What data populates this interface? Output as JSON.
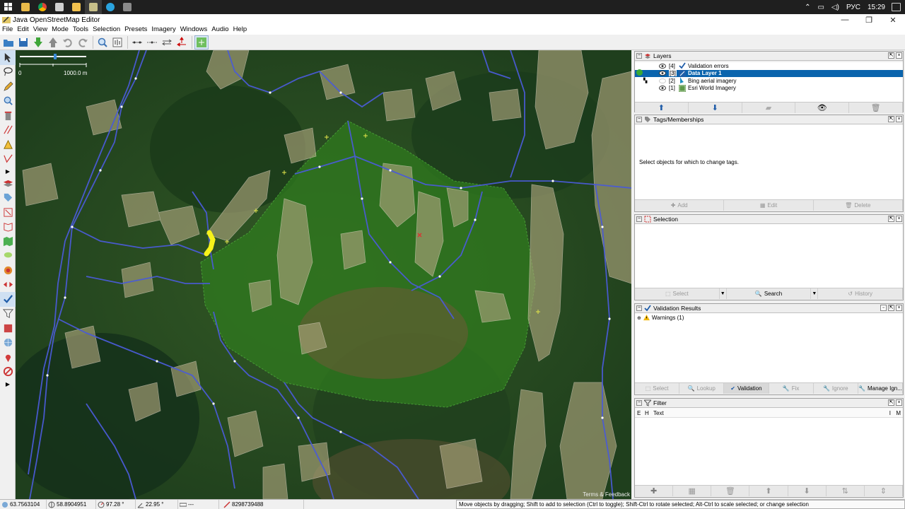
{
  "taskbar": {
    "apps": [
      {
        "name": "windows-icon",
        "color": "#ffffff"
      },
      {
        "name": "explorer-icon",
        "color": "#f2c14e"
      },
      {
        "name": "chrome-icon",
        "color": "#4caf50"
      },
      {
        "name": "desktop-icon",
        "color": "#d0d0d0"
      },
      {
        "name": "folder-icon",
        "color": "#f4c542"
      },
      {
        "name": "josm-icon",
        "color": "#d7c77a"
      },
      {
        "name": "telegram-icon",
        "color": "#2aa3de"
      },
      {
        "name": "calculator-icon",
        "color": "#9e9e9e"
      }
    ],
    "lang": "РУС",
    "time": "15:29"
  },
  "window": {
    "title": "Java OpenStreetMap Editor",
    "controls": [
      "—",
      "❐",
      "✕"
    ]
  },
  "menu": [
    "File",
    "Edit",
    "View",
    "Mode",
    "Tools",
    "Selection",
    "Presets",
    "Imagery",
    "Windows",
    "Audio",
    "Help"
  ],
  "map": {
    "scale_start": "0",
    "scale_end": "1000.0 m",
    "attribution": "Terms & Feedback"
  },
  "layers": {
    "title": "Layers",
    "items": [
      {
        "index": "[4]",
        "name": "Validation errors",
        "visible": true,
        "selected": false,
        "active": false
      },
      {
        "index": "[3]",
        "name": "Data Layer 1",
        "visible": true,
        "selected": true,
        "active": true
      },
      {
        "index": "[2]",
        "name": "Bing aerial imagery",
        "visible": false,
        "selected": false,
        "active": false
      },
      {
        "index": "[1]",
        "name": "Esri World Imagery",
        "visible": true,
        "selected": false,
        "active": false
      }
    ]
  },
  "tags": {
    "title": "Tags/Memberships",
    "empty_message": "Select objects for which to change tags.",
    "buttons": {
      "add": "Add",
      "edit": "Edit",
      "delete": "Delete"
    }
  },
  "selection": {
    "title": "Selection",
    "buttons": {
      "select": "Select",
      "search": "Search",
      "history": "History"
    }
  },
  "validation": {
    "title": "Validation Results",
    "tree_item": "Warnings (1)",
    "buttons": {
      "select": "Select",
      "lookup": "Lookup",
      "validation": "Validation",
      "fix": "Fix",
      "ignore": "Ignore",
      "manage": "Manage Ign..."
    }
  },
  "filter": {
    "title": "Filter",
    "col_e": "E",
    "col_h": "H",
    "col_text": "Text",
    "col_i": "I",
    "col_m": "M"
  },
  "status": {
    "lat": "63.7563104",
    "lon": "58.8904951",
    "heading": "97.28 °",
    "angle": "22.95 °",
    "length": "---",
    "id": "8298739488",
    "help": "Move objects by dragging; Shift to add to selection (Ctrl to toggle); Shift-Ctrl to rotate selected; Alt-Ctrl to scale selected; or change selection"
  }
}
